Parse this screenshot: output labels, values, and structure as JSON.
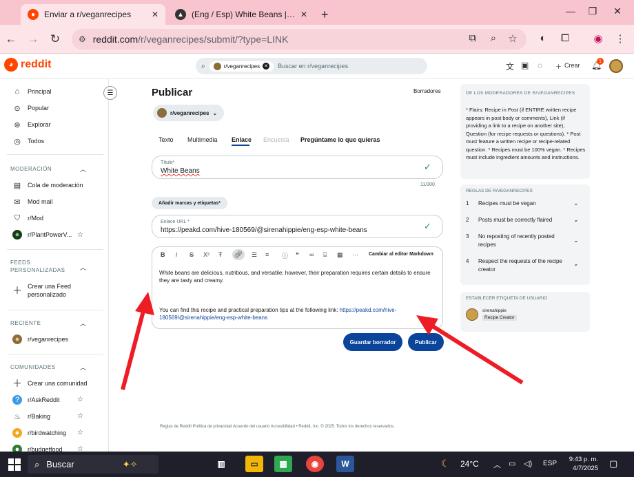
{
  "browser": {
    "tabs": [
      {
        "title": "Enviar a r/veganrecipes",
        "active": true
      },
      {
        "title": "(Eng / Esp) White Beans | PeakD",
        "active": false
      }
    ],
    "new_tab": "+",
    "url_main": "reddit.com",
    "url_rest": "/r/veganrecipes/submit/?type=LINK"
  },
  "header": {
    "logo_text": "reddit",
    "search_chip": "r/veganrecipes",
    "search_placeholder": "Buscar en r/veganrecipes",
    "create_label": "Crear",
    "notif_count": "1"
  },
  "sidebar": {
    "main": [
      {
        "label": "Principal",
        "icon": "home-icon"
      },
      {
        "label": "Popular",
        "icon": "popular-icon"
      },
      {
        "label": "Explorar",
        "icon": "explore-icon"
      },
      {
        "label": "Todos",
        "icon": "all-icon"
      }
    ],
    "moderation_title": "MODERACIÓN",
    "moderation": [
      {
        "label": "Cola de moderación"
      },
      {
        "label": "Mod mail"
      },
      {
        "label": "r/Mod"
      },
      {
        "label": "r/PlantPowerV..."
      }
    ],
    "feeds_title_1": "FEEDS",
    "feeds_title_2": "PERSONALIZADAS",
    "feeds_create_1": "Crear una Feed",
    "feeds_create_2": "personalizado",
    "recent_title": "RECIENTE",
    "recent": [
      {
        "label": "r/veganrecipes"
      }
    ],
    "communities_title": "COMUNIDADES",
    "communities": [
      {
        "label": "Crear una comunidad"
      },
      {
        "label": "r/AskReddit"
      },
      {
        "label": "r/Baking"
      },
      {
        "label": "r/birdwatching"
      },
      {
        "label": "r/budgetfood"
      }
    ]
  },
  "main": {
    "title": "Publicar",
    "drafts": "Borradores",
    "community": "r/veganrecipes",
    "tabs": [
      "Texto",
      "Multimedia",
      "Enlace",
      "Encuesta",
      "Pregúntame lo que quieras"
    ],
    "title_label": "Título*",
    "title_value": "White Beans",
    "title_count": "11/300",
    "tags_button": "Añadir marcas y etiquetas*",
    "url_label": "Enlace URL *",
    "url_value": "https://peakd.com/hive-180569/@sirenahippie/eng-esp-white-beans",
    "markdown_switch": "Cambiar al editor Markdown",
    "body_p1": "White beans are delicious, nutritious, and versatile; however, their preparation requires certain details to ensure they are tasty and creamy.",
    "body_p2_text": "You can find this recipe and practical preparation tips at the following link: ",
    "body_p2_link_a": "https://peakd.com/hive-",
    "body_p2_link_b": "180569/@sirenahippie/eng-esp-white-beans",
    "save_draft": "Guardar borrador",
    "publish": "Publicar",
    "footer": "Reglas de Reddit  Política de privacidad  Acuerdo del usuario  Accesibilidad  •  Reddit, Inc. © 2025. Todos los derechos reservados."
  },
  "right": {
    "mods_title": "DE LOS MODERADORES DE R/VEGANRECIPES",
    "mods_text": "* Flairs: Recipe in Post (if ENTIRE written recipe appears in post body or comments), Link (if providing a link to a recipe on another site), Question (for recipe requests or questions). * Post must feature a written recipe or recipe-related question. * Recipes must be 100% vegan. * Recipes must include ingredient amounts and instructions.",
    "rules_title": "REGLAS DE R/VEGANRECIPES",
    "rules": [
      {
        "n": "1",
        "text": "Recipes must be vegan"
      },
      {
        "n": "2",
        "text": "Posts must be correctly flaired"
      },
      {
        "n": "3",
        "text": "No reposting of recently posted recipes"
      },
      {
        "n": "4",
        "text": "Respect the requests of the recipe creator"
      }
    ],
    "flair_title": "ESTABLECER ETIQUETA DE USUARIO",
    "flair_user": "sirenahippie",
    "flair_tag": "Recipe Creator"
  },
  "taskbar": {
    "search": "Buscar",
    "temp": "24°C",
    "lang": "ESP",
    "time": "9:43 p. m.",
    "date": "4/7/2025"
  },
  "colors": {
    "accent": "#ff4500",
    "button": "#0a449b",
    "arrow": "#ee1c25",
    "tabstrip": "#f8c5cf"
  }
}
